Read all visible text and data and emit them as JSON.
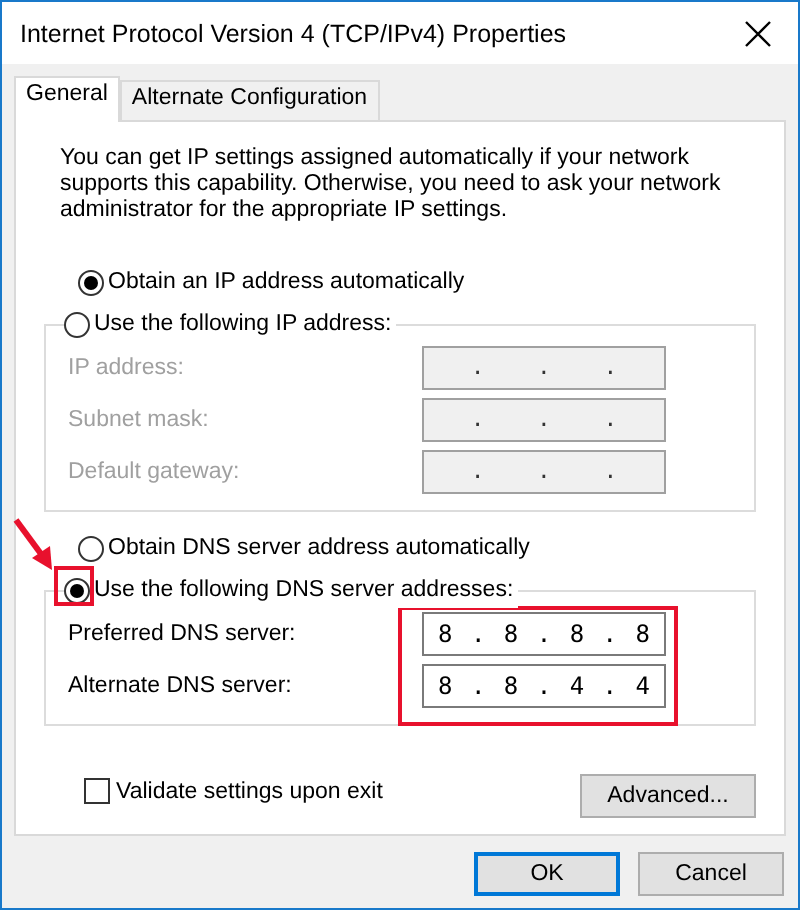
{
  "window": {
    "title": "Internet Protocol Version 4 (TCP/IPv4) Properties"
  },
  "tabs": [
    {
      "label": "General",
      "selected": true
    },
    {
      "label": "Alternate Configuration",
      "selected": false
    }
  ],
  "description": "You can get IP settings assigned automatically if your network supports this capability. Otherwise, you need to ask your network administrator for the appropriate IP settings.",
  "ip_section": {
    "auto_option": {
      "label": "Obtain an IP address automatically",
      "selected": true
    },
    "manual_option": {
      "label": "Use the following IP address:",
      "selected": false
    },
    "fields": [
      {
        "label": "IP address:",
        "value": ". . .",
        "disabled": true
      },
      {
        "label": "Subnet mask:",
        "value": ". . .",
        "disabled": true
      },
      {
        "label": "Default gateway:",
        "value": ". . .",
        "disabled": true
      }
    ]
  },
  "dns_section": {
    "auto_option": {
      "label": "Obtain DNS server address automatically",
      "selected": false
    },
    "manual_option": {
      "label": "Use the following DNS server addresses:",
      "selected": true
    },
    "fields": [
      {
        "label": "Preferred DNS server:",
        "value": "8 . 8 . 8 . 8",
        "disabled": false
      },
      {
        "label": "Alternate DNS server:",
        "value": "8 . 8 . 4 . 4",
        "disabled": false
      }
    ]
  },
  "validate": {
    "label": "Validate settings upon exit",
    "checked": false
  },
  "advanced_button": "Advanced...",
  "buttons": [
    {
      "label": "OK",
      "default": true
    },
    {
      "label": "Cancel",
      "default": false
    }
  ]
}
